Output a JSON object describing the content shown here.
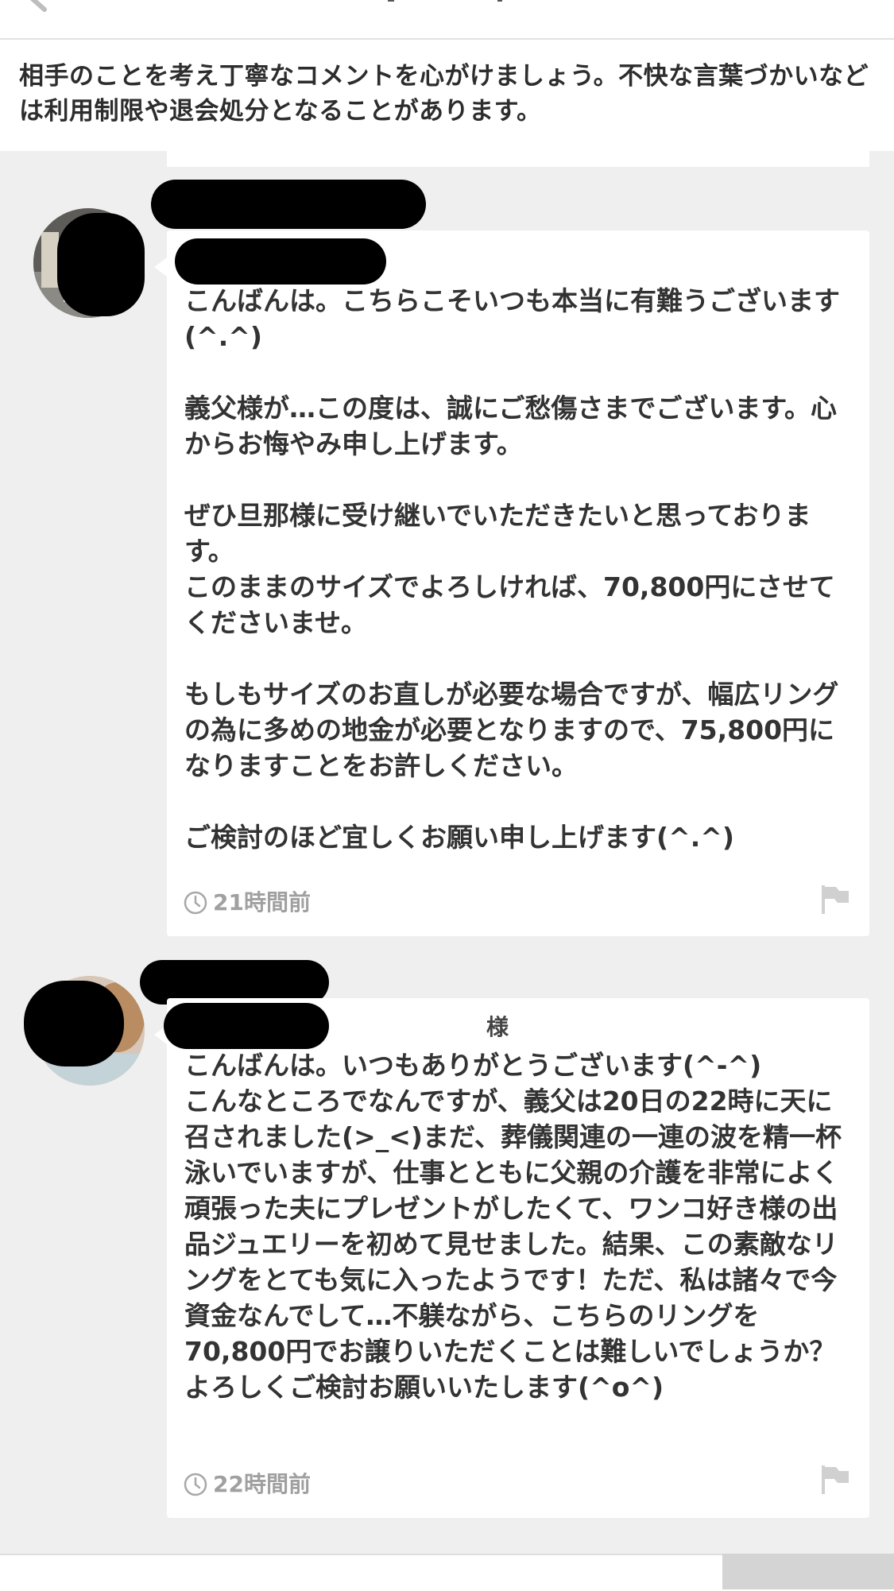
{
  "notice": {
    "text": "相手のことを考え丁寧なコメントを心がけましょう。不快な言葉づかいなどは利用制限や退会処分となることがあります。"
  },
  "comments": [
    {
      "addressee": "",
      "paragraphs": [
        "こんばんは。こちらこそいつも本当に有難うございます(^.^)",
        "",
        "義父様が…この度は、誠にご愁傷さまでございます。心からお悔やみ申し上げます。",
        "",
        "ぜひ旦那様に受け継いでいただきたいと思っております。",
        "このままのサイズでよろしければ、70,800円にさせてくださいませ。",
        "",
        "もしもサイズのお直しが必要な場合ですが、幅広リングの為に多めの地金が必要となりますので、75,800円になりますことをお許しください。",
        "",
        "ご検討のほど宜しくお願い申し上げます(^.^)"
      ],
      "time": "21時間前"
    },
    {
      "addressee": "様",
      "paragraphs": [
        "こんばんは。いつもありがとうございます(^-^)",
        "こんなところでなんですが、義父は20日の22時に天に召されました(>_<)まだ、葬儀関連の一連の波を精一杯泳いでいますが、仕事とともに父親の介護を非常によく頑張った夫にプレゼントがしたくて、ワンコ好き様の出品ジュエリーを初めて見せました。結果、この素敵なリングをとても気に入ったようです！ただ、私は諸々で今資金なんでして…不躾ながら、こちらのリングを70,800円でお譲りいただくことは難しいでしょうか？",
        "よろしくご検討お願いいたします(^o^)"
      ],
      "time": "22時間前"
    }
  ],
  "icons": {
    "back": "back-arrow-icon",
    "clock": "clock-icon",
    "report": "flag-icon"
  },
  "colors": {
    "background": "#efefef",
    "bubble": "#ffffff",
    "text": "#333333",
    "meta_text": "#a0a0a0",
    "redaction": "#000000"
  }
}
